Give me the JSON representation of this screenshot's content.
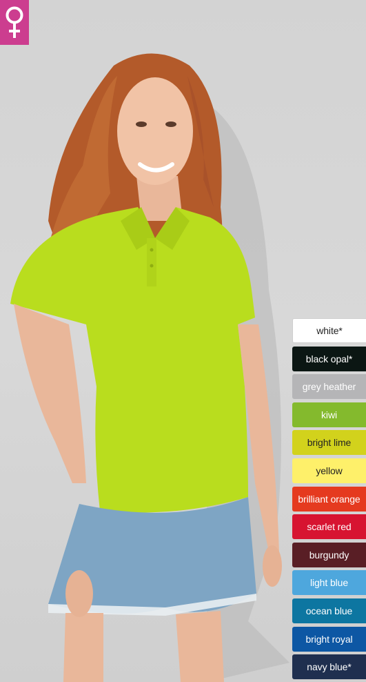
{
  "gender_badge": {
    "icon": "female-symbol-icon",
    "color": "#cc3d8f"
  },
  "product_photo": {
    "shirt_color": "#b9dd1e"
  },
  "colors": [
    {
      "label": "white*",
      "hex": "#ffffff",
      "text": "dark"
    },
    {
      "label": "black opal*",
      "hex": "#0b1613",
      "text": "light"
    },
    {
      "label": "grey heather",
      "hex": "#b5b5b7",
      "text": "light"
    },
    {
      "label": "kiwi",
      "hex": "#84ba2d",
      "text": "light"
    },
    {
      "label": "bright lime",
      "hex": "#d2d21c",
      "text": "dark"
    },
    {
      "label": "yellow",
      "hex": "#fef06a",
      "text": "dark"
    },
    {
      "label": "brilliant orange",
      "hex": "#e53a1f",
      "text": "light"
    },
    {
      "label": "scarlet red",
      "hex": "#d71431",
      "text": "light"
    },
    {
      "label": "burgundy",
      "hex": "#591e25",
      "text": "light"
    },
    {
      "label": "light blue",
      "hex": "#4ea7dd",
      "text": "light"
    },
    {
      "label": "ocean blue",
      "hex": "#0d76a1",
      "text": "light"
    },
    {
      "label": "bright royal",
      "hex": "#0d57a4",
      "text": "light"
    },
    {
      "label": "navy blue*",
      "hex": "#1f2f4f",
      "text": "light"
    }
  ]
}
